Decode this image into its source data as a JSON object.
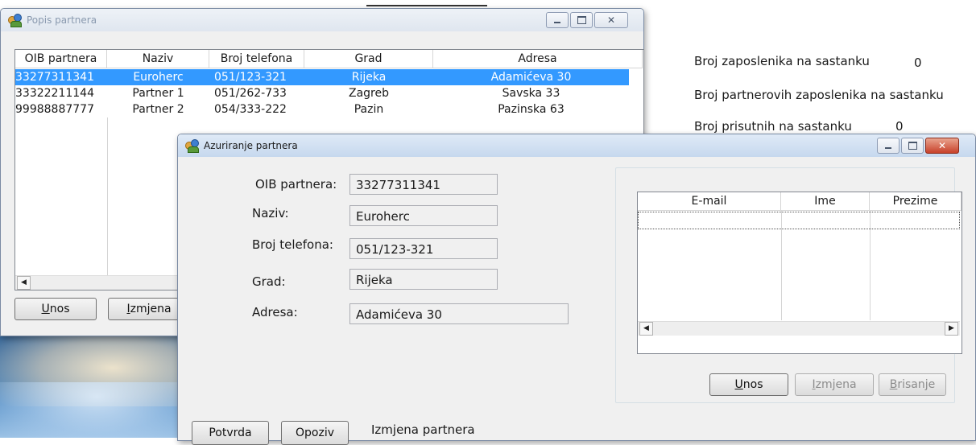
{
  "main_window": {
    "title": "Popis partnera",
    "columns": [
      "OIB partnera",
      "Naziv",
      "Broj telefona",
      "Grad",
      "Adresa"
    ],
    "rows": [
      [
        "33277311341",
        "Euroherc",
        "051/123-321",
        "Rijeka",
        "Adamićeva 30"
      ],
      [
        "33322211144",
        "Partner 1",
        "051/262-733",
        "Zagreb",
        "Savska 33"
      ],
      [
        "99988887777",
        "Partner 2",
        "054/333-222",
        "Pazin",
        "Pazinska 63"
      ]
    ],
    "selected_row": 0,
    "buttons": {
      "unos": "Unos",
      "izmjena": "Izmjena"
    }
  },
  "background_labels": {
    "broj_zaposlenika": "Broj zaposlenika na sastanku",
    "broj_zaposlenika_value": "0",
    "broj_partnerovih": "Broj partnerovih zaposlenika na sastanku",
    "broj_prisutnih": "Broj prisutnih na sastanku",
    "broj_prisutnih_value": "0"
  },
  "edit_window": {
    "title": "Azuriranje partnera",
    "fields": {
      "oib": {
        "label": "OIB partnera:",
        "value": "33277311341"
      },
      "naziv": {
        "label": "Naziv:",
        "value": "Euroherc"
      },
      "telefon": {
        "label": "Broj telefona:",
        "value": "051/123-321"
      },
      "grad": {
        "label": "Grad:",
        "value": "Rijeka"
      },
      "adresa": {
        "label": "Adresa:",
        "value": "Adamićeva 30"
      }
    },
    "contacts_columns": [
      "E-mail",
      "Ime",
      "Prezime"
    ],
    "contact_buttons": {
      "unos": "Unos",
      "izmjena": "Izmjena",
      "brisanje": "Brisanje"
    },
    "buttons": {
      "potvrda": "Potvrda",
      "opoziv": "Opoziv"
    },
    "mode_text": "Izmjena partnera"
  },
  "colors": {
    "selection": "#3399ff",
    "close_button": "#c8412a"
  },
  "icons": [
    "partners-icon",
    "minimize-icon",
    "maximize-icon",
    "close-icon",
    "scroll-left-icon",
    "scroll-right-icon"
  ]
}
